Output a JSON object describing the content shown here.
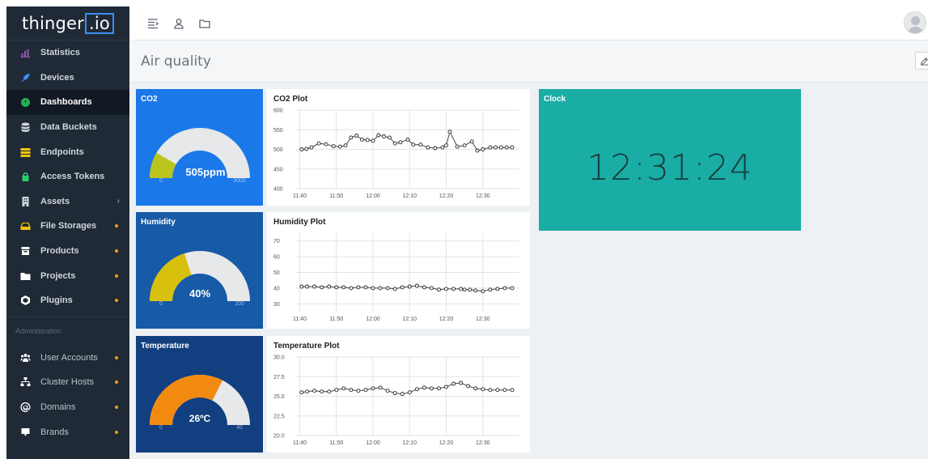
{
  "brand": {
    "name": "thinger",
    "suffix": ".io"
  },
  "sidebar": {
    "items": [
      {
        "label": "Statistics",
        "icon": "chart-icon",
        "icon_color": "#9b59b6"
      },
      {
        "label": "Devices",
        "icon": "rocket-icon",
        "icon_color": "#3b8ef3"
      },
      {
        "label": "Dashboards",
        "icon": "dashboard-icon",
        "icon_color": "#27ae60",
        "active": true
      },
      {
        "label": "Data Buckets",
        "icon": "database-icon",
        "icon_color": "#cfd6de"
      },
      {
        "label": "Endpoints",
        "icon": "endpoints-icon",
        "icon_color": "#f1c40f"
      },
      {
        "label": "Access Tokens",
        "icon": "lock-icon",
        "icon_color": "#2ecc71"
      },
      {
        "label": "Assets",
        "icon": "building-icon",
        "icon_color": "#cfd6de",
        "chevron": "›"
      },
      {
        "label": "File Storages",
        "icon": "drive-icon",
        "icon_color": "#f1c40f",
        "dot": true
      },
      {
        "label": "Products",
        "icon": "box-icon",
        "icon_color": "#ffffff",
        "dot": true
      },
      {
        "label": "Projects",
        "icon": "folder-icon",
        "icon_color": "#ffffff",
        "dot": true
      },
      {
        "label": "Plugins",
        "icon": "plugin-icon",
        "icon_color": "#ffffff",
        "dot": true
      }
    ],
    "admin_label": "Administration",
    "admin_items": [
      {
        "label": "User Accounts",
        "icon": "users-icon",
        "dot": true
      },
      {
        "label": "Cluster Hosts",
        "icon": "sitemap-icon",
        "dot": true
      },
      {
        "label": "Domains",
        "icon": "at-icon",
        "dot": true
      },
      {
        "label": "Brands",
        "icon": "brand-icon",
        "dot": true
      }
    ]
  },
  "topbar": {
    "icons": [
      "sidebar-toggle-icon",
      "user-icon",
      "folder-icon"
    ]
  },
  "page": {
    "title": "Air quality",
    "edit_icon": "edit-icon"
  },
  "widgets": {
    "co2": {
      "title": "CO2",
      "value_text": "505ppm",
      "min": "0",
      "max": "3000",
      "value": 505,
      "range": [
        0,
        3000
      ],
      "color": "#b9c51c",
      "track_color": "#e6e8ea"
    },
    "humidity": {
      "title": "Humidity",
      "value_text": "40%",
      "min": "0",
      "max": "100",
      "value": 40,
      "range": [
        0,
        100
      ],
      "color": "#d8c10c",
      "track_color": "#e6e8ea"
    },
    "temperature": {
      "title": "Temperature",
      "value_text": "26ºC",
      "min": "0",
      "max": "40",
      "value": 26,
      "range": [
        0,
        40
      ],
      "color": "#f28a10",
      "track_color": "#e6e8ea"
    },
    "clock": {
      "title": "Clock",
      "time": "12:31:24"
    }
  },
  "chart_data": [
    {
      "type": "line",
      "title": "CO2 Plot",
      "x_ticks": [
        "11:40",
        "11:50",
        "12:00",
        "12:10",
        "12:20",
        "12:30"
      ],
      "y_ticks": [
        "400",
        "450",
        "500",
        "550",
        "600"
      ],
      "ylim": [
        400,
        600
      ],
      "x_minutes": [
        -8.5,
        -7.2,
        -5.8,
        -3.8,
        -1.8,
        0.2,
        2.0,
        3.5,
        5.0,
        6.5,
        8.0,
        9.5,
        11.0,
        12.5,
        14.0,
        15.5,
        17.0,
        18.5,
        20.5,
        22.0,
        24.0,
        26.0,
        28.0,
        30.0,
        31.0,
        32.0,
        34.0,
        36.0,
        38.0,
        39.5,
        41.0,
        43.0,
        44.5,
        46.0,
        47.5,
        49.0
      ],
      "values": [
        500,
        501,
        505,
        515,
        513,
        508,
        507,
        510,
        530,
        535,
        525,
        524,
        522,
        536,
        533,
        530,
        515,
        518,
        525,
        512,
        512,
        505,
        503,
        505,
        510,
        545,
        507,
        510,
        520,
        497,
        500,
        505,
        505,
        505,
        505,
        505
      ],
      "grid": true,
      "line_color": "#444444"
    },
    {
      "type": "line",
      "title": "Humidity Plot",
      "x_ticks": [
        "11:40",
        "11:50",
        "12:00",
        "12:10",
        "12:20",
        "12:30"
      ],
      "y_ticks": [
        "30",
        "40",
        "50",
        "60",
        "70"
      ],
      "ylim": [
        25,
        75
      ],
      "x_minutes": [
        -8.5,
        -7.0,
        -5.0,
        -3.0,
        -1.0,
        1.0,
        3.0,
        5.0,
        7.0,
        9.0,
        11.0,
        13.0,
        15.0,
        17.0,
        19.0,
        21.0,
        23.0,
        25.0,
        27.0,
        29.0,
        31.0,
        33.0,
        35.0,
        36.0,
        37.5,
        39.0,
        41.0,
        43.0,
        45.0,
        47.0,
        49.0
      ],
      "values": [
        41,
        41,
        41,
        40.5,
        41,
        40.5,
        40.5,
        40,
        40.5,
        40.5,
        40,
        40,
        40,
        39.5,
        40.5,
        41,
        41.5,
        40.5,
        40,
        39,
        39.5,
        39.5,
        39.5,
        39,
        39,
        38.5,
        38,
        39,
        39.5,
        40,
        40
      ],
      "grid": true,
      "line_color": "#444444"
    },
    {
      "type": "line",
      "title": "Temperature Plot",
      "x_ticks": [
        "11:40",
        "11:50",
        "12:00",
        "12:10",
        "12:20",
        "12:30"
      ],
      "y_ticks": [
        "20.0",
        "22.5",
        "25.0",
        "27.5",
        "30.0"
      ],
      "ylim": [
        20,
        30
      ],
      "x_minutes": [
        -8.5,
        -7.0,
        -5.0,
        -3.0,
        -1.0,
        1.0,
        3.0,
        5.0,
        7.0,
        9.0,
        11.0,
        13.0,
        15.0,
        17.0,
        19.0,
        21.0,
        23.0,
        25.0,
        27.0,
        29.0,
        31.0,
        33.0,
        35.0,
        37.0,
        39.0,
        41.0,
        43.0,
        45.0,
        47.0,
        49.0
      ],
      "values": [
        25.5,
        25.6,
        25.7,
        25.6,
        25.6,
        25.8,
        26.0,
        25.8,
        25.7,
        25.8,
        26.0,
        26.1,
        25.7,
        25.4,
        25.3,
        25.5,
        25.9,
        26.1,
        26.0,
        26.0,
        26.2,
        26.6,
        26.7,
        26.3,
        26.0,
        25.9,
        25.8,
        25.8,
        25.8,
        25.8
      ],
      "grid": true,
      "line_color": "#444444"
    }
  ]
}
